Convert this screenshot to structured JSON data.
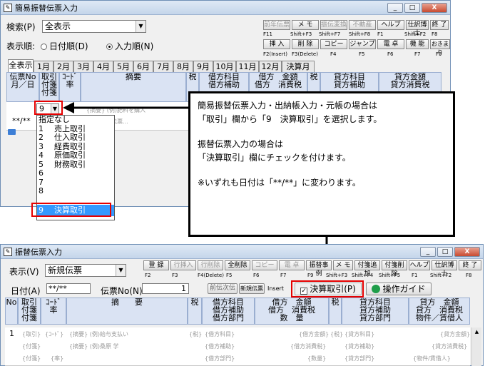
{
  "win1": {
    "title": "簡易振替伝票入力",
    "window_buttons": [
      "_",
      "□",
      "X"
    ],
    "search_label": "検索(P)",
    "search_value": "全表示",
    "order_label": "表示順:",
    "order_date": "日付順(D)",
    "order_input": "入力順(N)",
    "fkeys_row1": [
      {
        "label": "前年伝票",
        "sub": "F11"
      },
      {
        "label": "メ モ",
        "sub": "Shift+F3"
      },
      {
        "label": "振伝変換",
        "sub": "Shift+F7"
      },
      {
        "label": "不動産",
        "sub": "Shift+F8"
      },
      {
        "label": "ヘルプ",
        "sub": "F1"
      },
      {
        "label": "仕訳博士",
        "sub": "Shift+F2"
      },
      {
        "label": "終 了",
        "sub": "F8"
      }
    ],
    "fkeys_row2": [
      {
        "label": "挿 入",
        "sub": "F2(Insert)"
      },
      {
        "label": "削 除",
        "sub": "F3(Delete)"
      },
      {
        "label": "コピー",
        "sub": "F4"
      },
      {
        "label": "ジャンプ",
        "sub": "F5"
      },
      {
        "label": "電 卓",
        "sub": "F6"
      },
      {
        "label": "機 能",
        "sub": "F7"
      },
      {
        "label": "おきまり",
        "sub": "F9"
      }
    ],
    "tabs": [
      "全表示",
      "1月",
      "2月",
      "3月",
      "4月",
      "5月",
      "6月",
      "7月",
      "8月",
      "9月",
      "10月",
      "11月",
      "12月",
      "決算月"
    ],
    "headers": {
      "c1": [
        "伝票No",
        "月／日"
      ],
      "c2": [
        "取引",
        "付箋",
        "付箋"
      ],
      "c3": [
        "ｺｰﾄﾞ",
        "",
        "率"
      ],
      "c4": "摘要",
      "c5": "税",
      "c6": [
        "借方科目",
        "借方補助"
      ],
      "c7": [
        "借方　金額",
        "借方　消費税"
      ],
      "c8": "税",
      "c9": [
        "貸方科目",
        "貸方補助"
      ],
      "c10": [
        "貸方金額",
        "貸方消費税"
      ]
    },
    "row": {
      "torihiki_value": "9",
      "tekiyo_placeholder": "{摘要} (例)肥料を購入",
      "date_value": "**/**",
      "kubun_placeholder": "{伝票..."
    },
    "dropdown_items": [
      {
        "num": "",
        "label": "指定なし"
      },
      {
        "num": "1",
        "label": "売上取引"
      },
      {
        "num": "2",
        "label": "仕入取引"
      },
      {
        "num": "3",
        "label": "経費取引"
      },
      {
        "num": "4",
        "label": "原価取引"
      },
      {
        "num": "5",
        "label": "財務取引"
      },
      {
        "num": "6",
        "label": ""
      },
      {
        "num": "7",
        "label": ""
      },
      {
        "num": "8",
        "label": ""
      },
      {
        "num": "9",
        "label": "決算取引"
      }
    ]
  },
  "callout": {
    "line1": "簡易振替伝票入力・出納帳入力・元帳の場合は",
    "line2": "「取引」欄から「9　決算取引」を選択します。",
    "line3": "振替伝票入力の場合は",
    "line4": "「決算取引」欄にチェックを付けます。",
    "line5": "※いずれも日付は「**/**」に変わります。"
  },
  "win2": {
    "title": "振替伝票入力",
    "window_buttons": [
      "_",
      "□",
      "X"
    ],
    "display_label": "表示(V)",
    "display_value": "新規伝票",
    "fkeys": [
      {
        "label": "登 録",
        "sub": "F2",
        "state": "normal"
      },
      {
        "label": "行挿入",
        "sub": "F3",
        "state": "dis"
      },
      {
        "label": "行削除",
        "sub": "F4(Delete)",
        "state": "dis"
      },
      {
        "label": "全削除",
        "sub": "F5",
        "state": "normal"
      },
      {
        "label": "コピー",
        "sub": "F6",
        "state": "dis"
      },
      {
        "label": "電 卓",
        "sub": "F7",
        "state": "dis"
      },
      {
        "label": "振替事例",
        "sub": "F9",
        "state": "normal"
      },
      {
        "label": "メ モ",
        "sub": "Shift+F3",
        "state": "normal"
      },
      {
        "label": "付箋追加",
        "sub": "Shift+F4",
        "state": "normal"
      },
      {
        "label": "付箋削除",
        "sub": "Shift+F5",
        "state": "normal"
      },
      {
        "label": "ヘルプ",
        "sub": "F1",
        "state": "normal"
      },
      {
        "label": "仕訳博士",
        "sub": "Shift+F2",
        "state": "normal"
      },
      {
        "label": "終 了",
        "sub": "F8",
        "state": "normal"
      }
    ],
    "date_label": "日付(A)",
    "date_value": "**/**",
    "denpyo_label": "伝票No(N)",
    "denpyo_value": "1",
    "prev_btn": "前伝",
    "next_btn": "次伝",
    "new_btn": "新規伝票",
    "insert_label": "Insert",
    "kessan_check": "決算取引(P)",
    "guide_btn": "操作ガイド",
    "headers": {
      "c1": "No",
      "c2": [
        "取引",
        "付箋",
        "付箋"
      ],
      "c3": [
        "ｺｰﾄﾞ",
        "",
        "率"
      ],
      "c4": "摘　　要",
      "c5": "税",
      "c6": [
        "借方科目",
        "借方補助",
        "借方部門"
      ],
      "c7": [
        "借方　金額",
        "借方　消費税",
        "数　量"
      ],
      "c8": "税",
      "c9": [
        "貸方科目",
        "貸方補助",
        "貸方部門"
      ],
      "c10": [
        "貸方　金額",
        "貸方　消費税",
        "物件／賃借人"
      ]
    },
    "row1": {
      "no": "1",
      "torihiki": "{取引}",
      "code": "{ｺｰﾄﾞ}",
      "tekiyo": "{摘要} (例)給与支払い",
      "zei": "{税}",
      "karikata": "{借方科目}",
      "karikingaku": "{借方金額}",
      "zei2": "{税}",
      "kashikata": "{貸方科目}",
      "kashikingaku": "{貸方金額}"
    },
    "row2": {
      "fusen": "{付箋}",
      "tekiyo": "{摘要} (例)桑原 学",
      "karihojo": "{借方補助}",
      "karizei": "{借方消費税}",
      "kashihojo": "{貸方補助}",
      "kashizei": "{貸方消費税}"
    },
    "row3": {
      "fusen": "{付箋}",
      "ritsu": "{率}",
      "karibumon": "{借方部門}",
      "suryo": "{数量}",
      "kashibumon": "{貸方部門}",
      "bukken": "{物件/賃借人}"
    }
  }
}
